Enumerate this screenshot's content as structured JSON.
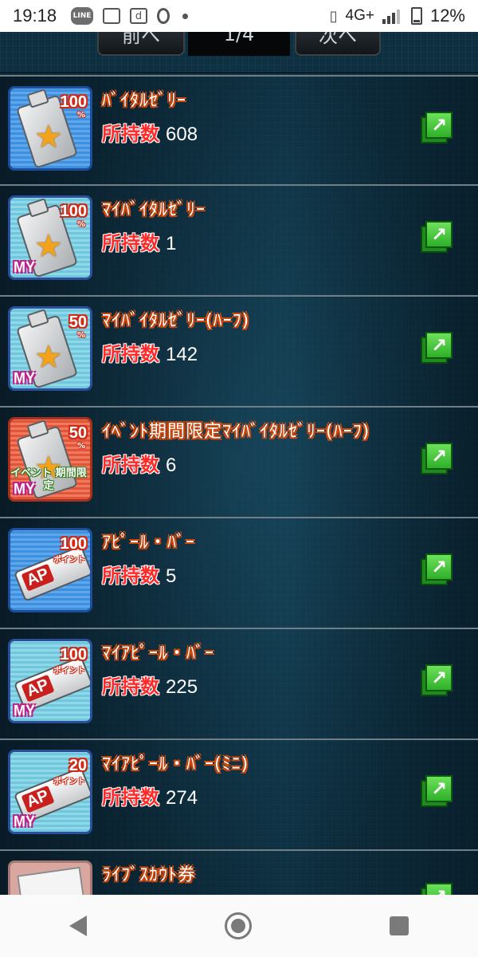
{
  "status_bar": {
    "time": "19:18",
    "line_label": "LINE",
    "d_label": "d",
    "network": "4G+",
    "battery": "12%"
  },
  "pager": {
    "prev_label": "前へ",
    "page_label": "1/4",
    "next_label": "次へ"
  },
  "items": [
    {
      "name": "ﾊﾞｲﾀﾙｾﾞﾘｰ",
      "count_label": "所持数",
      "count": "608",
      "badge": "100",
      "badge_sub": "%",
      "my": "",
      "event": ""
    },
    {
      "name": "ﾏｲﾊﾞｲﾀﾙｾﾞﾘｰ",
      "count_label": "所持数",
      "count": "1",
      "badge": "100",
      "badge_sub": "%",
      "my": "MY",
      "event": ""
    },
    {
      "name": "ﾏｲﾊﾞｲﾀﾙｾﾞﾘｰ(ﾊｰﾌ)",
      "count_label": "所持数",
      "count": "142",
      "badge": "50",
      "badge_sub": "%",
      "my": "MY",
      "event": ""
    },
    {
      "name": "ｲﾍﾞﾝﾄ期間限定ﾏｲﾊﾞｲﾀﾙｾﾞﾘｰ(ﾊｰﾌ)",
      "count_label": "所持数",
      "count": "6",
      "badge": "50",
      "badge_sub": "%",
      "my": "MY",
      "event": "イベント 期間限定"
    },
    {
      "name": "ｱﾋﾟｰﾙ・ﾊﾞｰ",
      "count_label": "所持数",
      "count": "5",
      "badge": "100",
      "badge_sub": "ポイント",
      "my": "",
      "event": ""
    },
    {
      "name": "ﾏｲｱﾋﾟｰﾙ・ﾊﾞｰ",
      "count_label": "所持数",
      "count": "225",
      "badge": "100",
      "badge_sub": "ポイント",
      "my": "MY",
      "event": ""
    },
    {
      "name": "ﾏｲｱﾋﾟｰﾙ・ﾊﾞｰ(ﾐﾆ)",
      "count_label": "所持数",
      "count": "274",
      "badge": "20",
      "badge_sub": "ポイント",
      "my": "MY",
      "event": ""
    },
    {
      "name": "ﾗｲﾌﾞｽｶｳﾄ券",
      "count_label": "",
      "count": "",
      "badge": "",
      "badge_sub": "",
      "my": "",
      "event": ""
    }
  ],
  "icons": {
    "link": "external-link-icon",
    "back": "back-icon",
    "home": "home-icon",
    "recent": "recent-apps-icon"
  },
  "colors": {
    "name_outline": "#d0470a",
    "count_label": "#ff2a2a",
    "link_green": "#2fb02a"
  }
}
